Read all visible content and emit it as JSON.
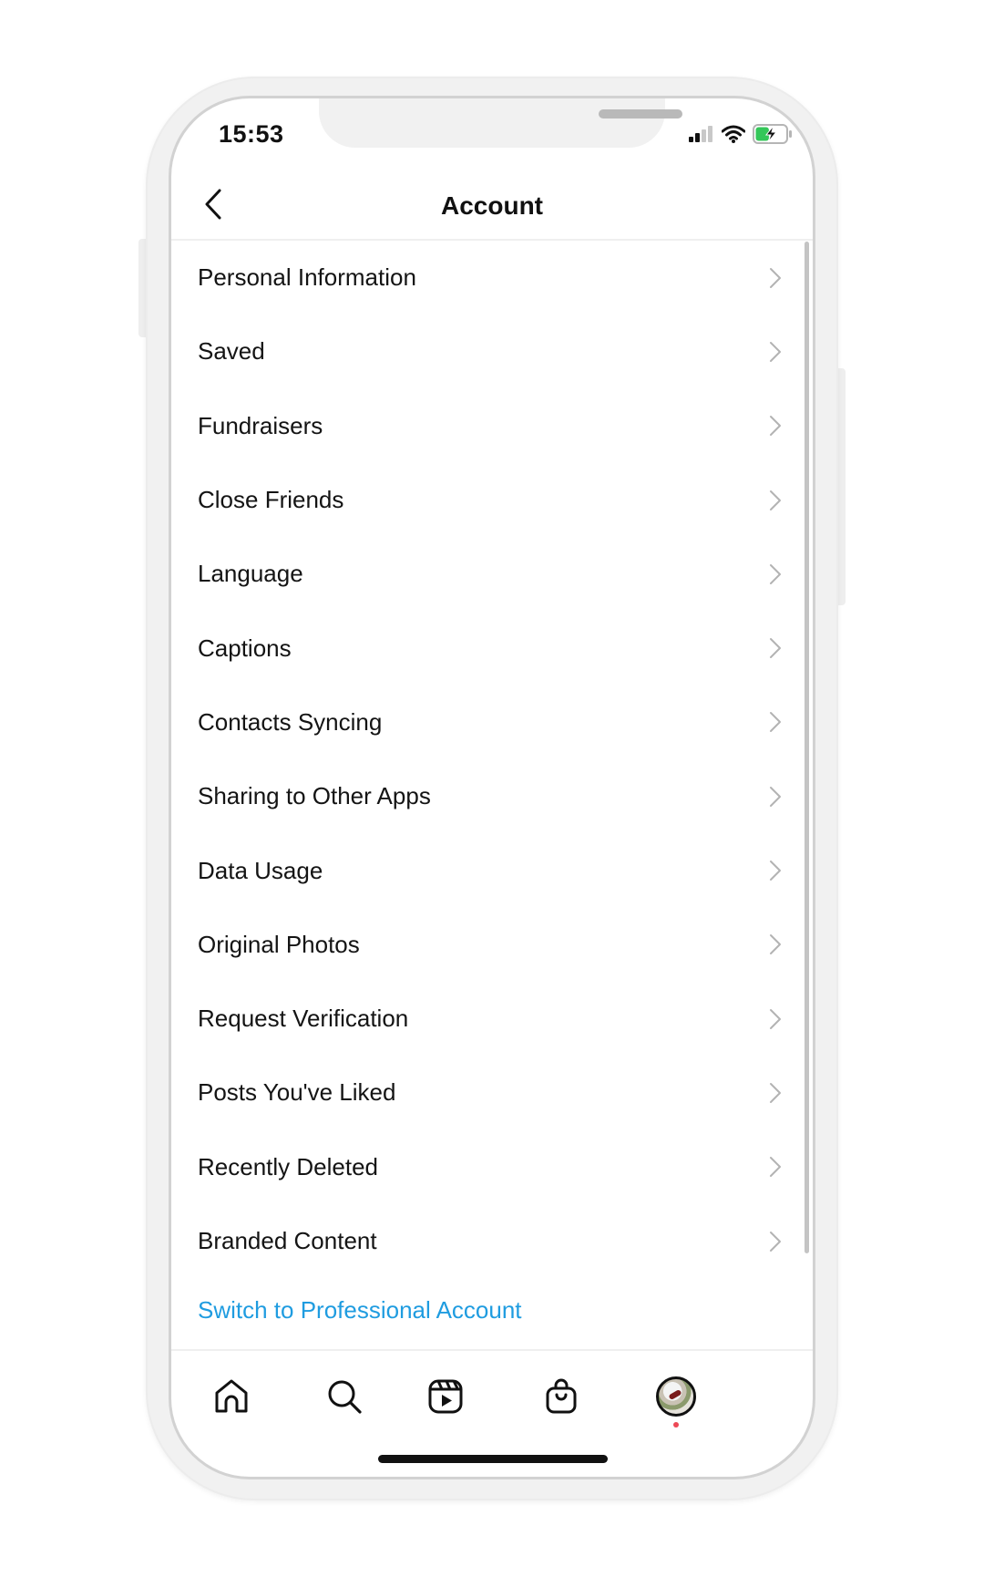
{
  "status_bar": {
    "time": "15:53",
    "signal_bars_active": 2,
    "signal_bars_total": 4,
    "wifi": "wifi-icon",
    "battery_level_fraction": 0.45,
    "battery_charging": true,
    "battery_color": "#34c759"
  },
  "header": {
    "title": "Account",
    "back_icon": "chevron-left-icon"
  },
  "menu": {
    "items": [
      {
        "label": "Personal Information"
      },
      {
        "label": "Saved"
      },
      {
        "label": "Fundraisers"
      },
      {
        "label": "Close Friends"
      },
      {
        "label": "Language"
      },
      {
        "label": "Captions"
      },
      {
        "label": "Contacts Syncing"
      },
      {
        "label": "Sharing to Other Apps"
      },
      {
        "label": "Data Usage"
      },
      {
        "label": "Original Photos"
      },
      {
        "label": "Request Verification"
      },
      {
        "label": "Posts You've Liked"
      },
      {
        "label": "Recently Deleted"
      },
      {
        "label": "Branded Content"
      }
    ],
    "chevron_icon": "chevron-right-icon"
  },
  "switch_link": {
    "label": "Switch to Professional Account",
    "color": "#1f9ce0"
  },
  "tabbar": {
    "tabs": [
      {
        "name": "home",
        "icon": "home-icon"
      },
      {
        "name": "search",
        "icon": "search-icon"
      },
      {
        "name": "reels",
        "icon": "reels-icon"
      },
      {
        "name": "shop",
        "icon": "shopping-bag-icon"
      },
      {
        "name": "profile",
        "icon": "avatar",
        "has_notification_dot": true
      }
    ],
    "notification_dot_color": "#ed4956"
  }
}
